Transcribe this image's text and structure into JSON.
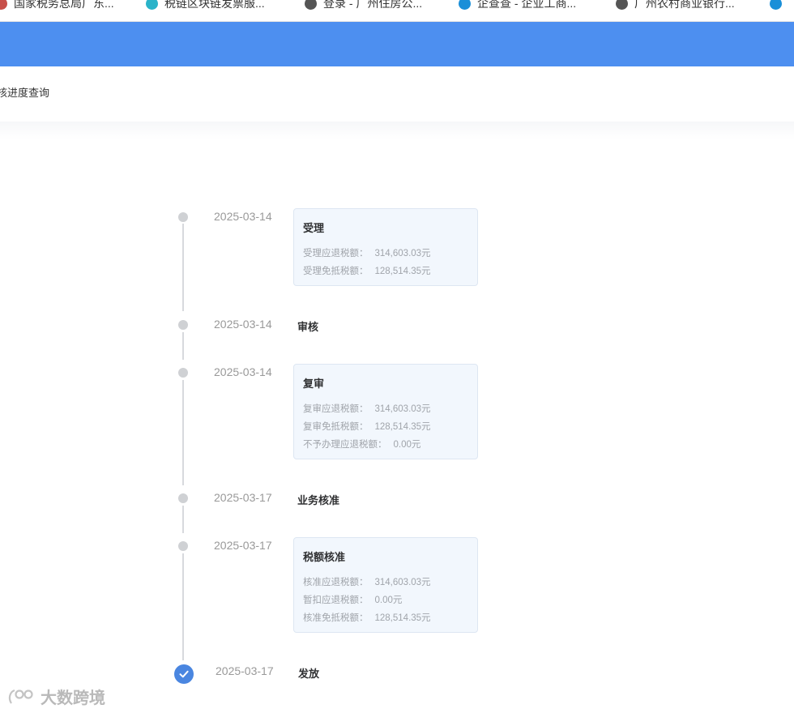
{
  "bookmarks": [
    {
      "label": "国家税务总局广东...",
      "icon_color": "#c8504a"
    },
    {
      "label": "税链区块链发票服...",
      "icon_color": "#2ab3c9"
    },
    {
      "label": "登录 - 广州住房公...",
      "icon_color": "#555555"
    },
    {
      "label": "企查查 - 企业工商...",
      "icon_color": "#1a8fd8"
    },
    {
      "label": "广州农村商业银行...",
      "icon_color": "#555555"
    }
  ],
  "header": {
    "color": "#4d8ff0"
  },
  "breadcrumb": "核进度查询",
  "timeline": [
    {
      "date": "2025-03-14",
      "title": "受理",
      "lines": [
        {
          "label": "受理应退税额：",
          "value": "314,603.03元"
        },
        {
          "label": "受理免抵税额：",
          "value": "128,514.35元"
        }
      ]
    },
    {
      "date": "2025-03-14",
      "title": "审核",
      "lines": []
    },
    {
      "date": "2025-03-14",
      "title": "复审",
      "lines": [
        {
          "label": "复审应退税额：",
          "value": "314,603.03元"
        },
        {
          "label": "复审免抵税额：",
          "value": "128,514.35元"
        },
        {
          "label": "不予办理应退税额：",
          "value": "0.00元"
        }
      ]
    },
    {
      "date": "2025-03-17",
      "title": "业务核准",
      "lines": []
    },
    {
      "date": "2025-03-17",
      "title": "税额核准",
      "lines": [
        {
          "label": "核准应退税额：",
          "value": "314,603.03元"
        },
        {
          "label": "暂扣应退税额：",
          "value": "0.00元"
        },
        {
          "label": "核准免抵税额：",
          "value": "128,514.35元"
        }
      ]
    },
    {
      "date": "2025-03-17",
      "title": "发放",
      "lines": [],
      "completed": true
    }
  ],
  "watermark": "大数跨境",
  "colors": {
    "accent": "#4a86e0",
    "card_bg": "#f2f7fd"
  }
}
